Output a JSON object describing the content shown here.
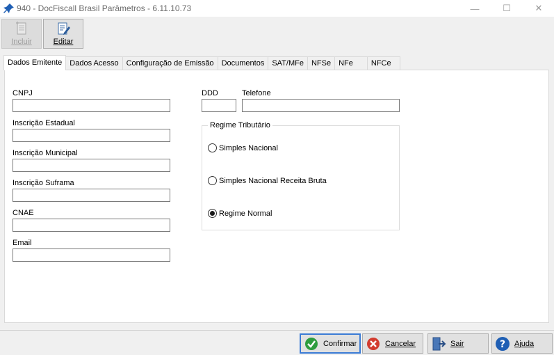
{
  "window": {
    "title": "940 - DocFiscall Brasil Parâmetros - 6.11.10.73",
    "minimize": "—",
    "maximize": "☐",
    "close": "✕"
  },
  "toolbar": {
    "incluir_label": "Incluir",
    "editar_label": "Editar"
  },
  "tabs": [
    {
      "label": "Dados Emitente",
      "active": true
    },
    {
      "label": "Dados Acesso"
    },
    {
      "label": "Configuração de Emissão"
    },
    {
      "label": "Documentos"
    },
    {
      "label": "SAT/MFe"
    },
    {
      "label": "NFSe"
    },
    {
      "label": "NFe"
    },
    {
      "label": "NFCe"
    }
  ],
  "form": {
    "cnpj_label": "CNPJ",
    "cnpj_value": "",
    "ie_label": "Inscrição Estadual",
    "ie_value": "",
    "im_label": "Inscrição Municipal",
    "im_value": "",
    "suframa_label": "Inscrição Suframa",
    "suframa_value": "",
    "cnae_label": "CNAE",
    "cnae_value": "",
    "email_label": "Email",
    "email_value": "",
    "ddd_label": "DDD",
    "ddd_value": "",
    "telefone_label": "Telefone",
    "telefone_value": ""
  },
  "regime": {
    "legend": "Regime Tributário",
    "options": [
      {
        "label": "Simples Nacional",
        "checked": false
      },
      {
        "label": "Simples Nacional Receita Bruta",
        "checked": false
      },
      {
        "label": "Regime Normal",
        "checked": true
      }
    ]
  },
  "buttons": {
    "confirmar": "Confirmar",
    "cancelar": "Cancelar",
    "sair": "Sair",
    "ajuda": "Ajuda"
  },
  "colors": {
    "confirm_green": "#2e9c3f",
    "cancel_red": "#d23b2e",
    "help_blue": "#1f5fb4",
    "focus_border": "#3a7bd5"
  }
}
